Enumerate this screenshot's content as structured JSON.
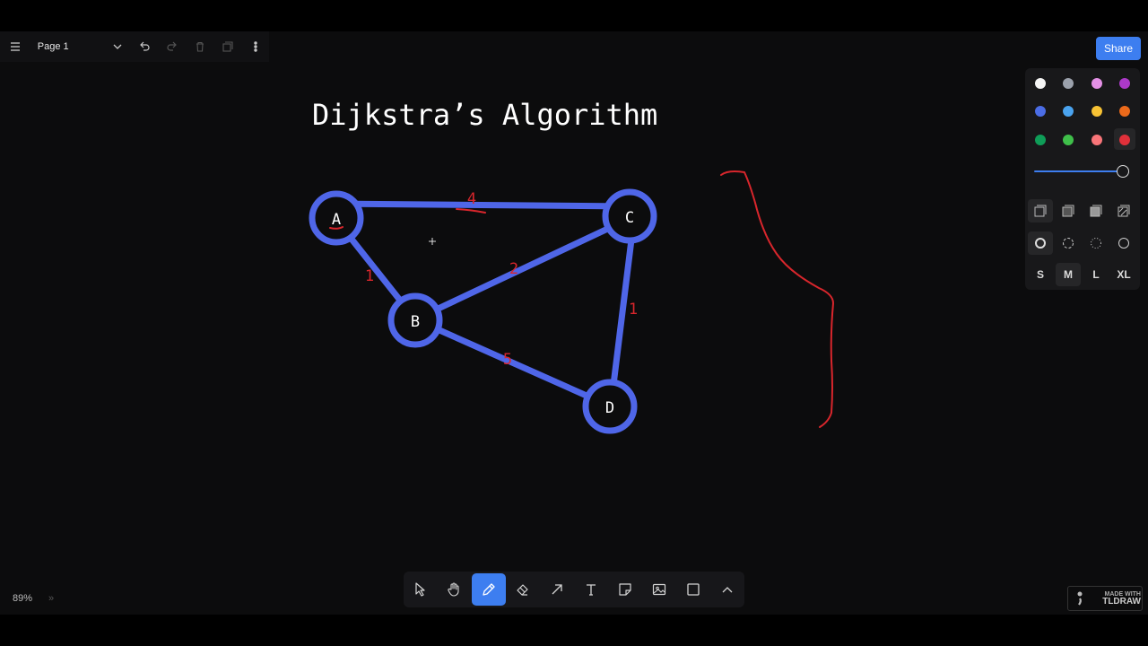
{
  "top_bar": {
    "page_name": "Page 1",
    "icons": [
      "menu-icon",
      "chevron-down-icon",
      "undo-icon",
      "redo-icon",
      "trash-icon",
      "duplicate-icon",
      "more-icon"
    ]
  },
  "share_label": "Share",
  "canvas": {
    "title": "Dijkstra’s Algorithm",
    "nodes": [
      "A",
      "B",
      "C",
      "D"
    ],
    "edge_weights": {
      "a_c": "4",
      "a_b": "1",
      "b_c": "2",
      "c_d": "1",
      "b_d": "5"
    },
    "colors": {
      "edge": "#4f66e8",
      "annotation": "#d8262c",
      "text": "#ffffff"
    }
  },
  "style_panel": {
    "colors": [
      "#f4f4f4",
      "#9ba1ac",
      "#e490e6",
      "#ac39c9",
      "#4b6de6",
      "#4aa3ef",
      "#f7c234",
      "#ec6a1b",
      "#0f9d58",
      "#3fbf4a",
      "#f87579",
      "#e0303a"
    ],
    "selected_color": "#e0303a",
    "opacity": 1.0,
    "fill_styles": [
      "fill-none-icon",
      "fill-semi-icon",
      "fill-solid-icon",
      "fill-pattern-icon"
    ],
    "dash_styles": [
      "dash-draw-icon",
      "dash-dashed-icon",
      "dash-dotted-icon",
      "dash-solid-icon"
    ],
    "sizes": [
      "S",
      "M",
      "L",
      "XL"
    ],
    "selected_size": "M"
  },
  "zoom": "89%",
  "toolbar": {
    "tools": [
      "select-icon",
      "hand-icon",
      "draw-icon",
      "eraser-icon",
      "arrow-icon",
      "text-icon",
      "note-icon",
      "image-icon",
      "rectangle-icon",
      "more-tools-icon"
    ],
    "active_tool": "draw-icon"
  },
  "watermark": {
    "line1": "MADE WITH",
    "line2": "TLDRAW"
  }
}
